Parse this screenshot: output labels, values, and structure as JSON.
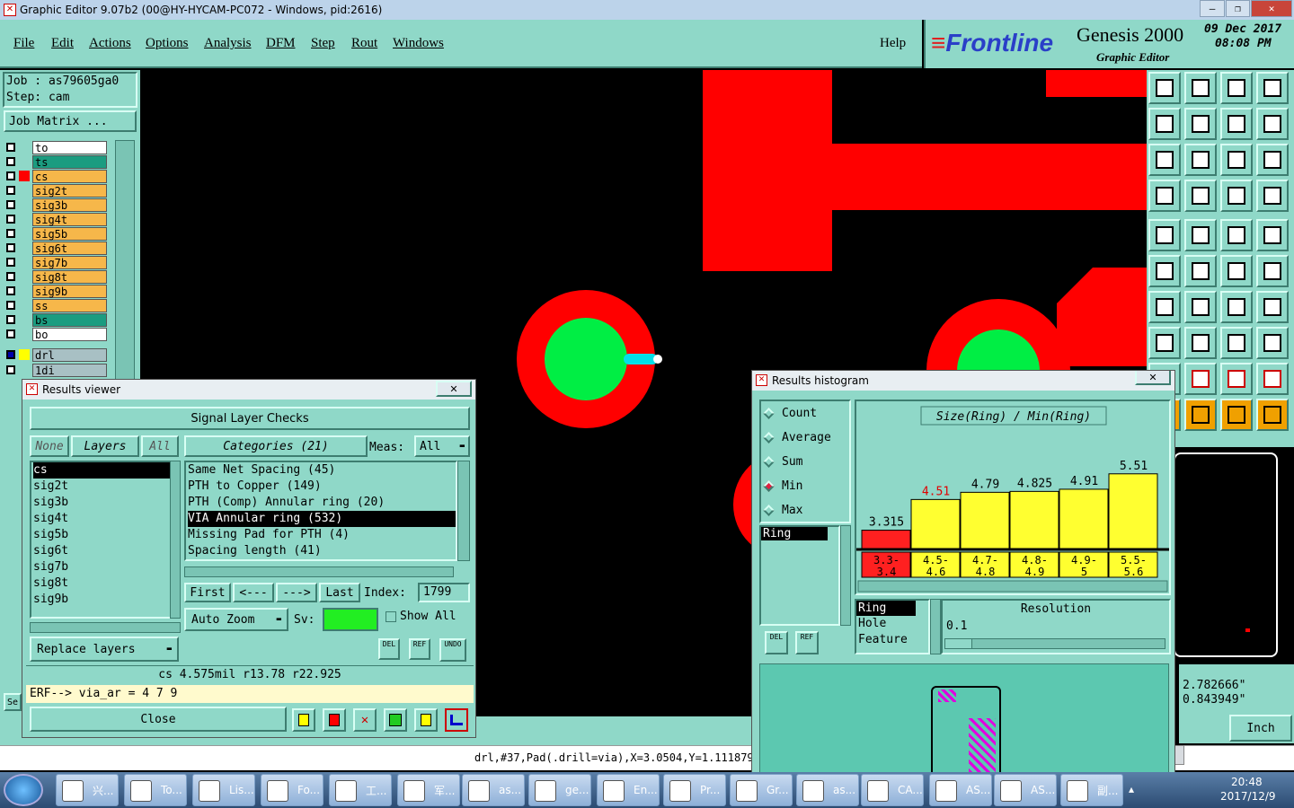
{
  "window": {
    "title": "Graphic Editor 9.07b2 (00@HY-HYCAM-PC072 - Windows, pid:2616)"
  },
  "menu": [
    "File",
    "Edit",
    "Actions",
    "Options",
    "Analysis",
    "DFM",
    "Step",
    "Rout",
    "Windows"
  ],
  "help": "Help",
  "brand": {
    "logo": "Frontline",
    "product": "Genesis 2000",
    "subtitle": "Graphic Editor",
    "date": "09 Dec 2017",
    "time": "08:08 PM"
  },
  "job": {
    "job": "Job : as79605ga0",
    "step": "Step: cam",
    "matrix_button": "Job Matrix ..."
  },
  "layers": [
    {
      "name": "to",
      "color": "#ffffff",
      "swatch": ""
    },
    {
      "name": "ts",
      "color": "#1b9c80",
      "swatch": ""
    },
    {
      "name": "cs",
      "color": "#f6b74a",
      "swatch": "#ff0000"
    },
    {
      "name": "sig2t",
      "color": "#f6b74a",
      "swatch": ""
    },
    {
      "name": "sig3b",
      "color": "#f6b74a",
      "swatch": ""
    },
    {
      "name": "sig4t",
      "color": "#f6b74a",
      "swatch": ""
    },
    {
      "name": "sig5b",
      "color": "#f6b74a",
      "swatch": ""
    },
    {
      "name": "sig6t",
      "color": "#f6b74a",
      "swatch": ""
    },
    {
      "name": "sig7b",
      "color": "#f6b74a",
      "swatch": ""
    },
    {
      "name": "sig8t",
      "color": "#f6b74a",
      "swatch": ""
    },
    {
      "name": "sig9b",
      "color": "#f6b74a",
      "swatch": ""
    },
    {
      "name": "ss",
      "color": "#f6b74a",
      "swatch": ""
    },
    {
      "name": "bs",
      "color": "#1b9c80",
      "swatch": ""
    },
    {
      "name": "bo",
      "color": "#ffffff",
      "swatch": ""
    }
  ],
  "drill_layers": [
    {
      "name": "drl",
      "swatch": "#ffff00"
    },
    {
      "name": "1di",
      "swatch": ""
    }
  ],
  "results_viewer": {
    "title": "Results viewer",
    "header": "Signal Layer Checks",
    "none": "None",
    "layers_label": "Layers",
    "all": "All",
    "categories_label": "Categories (21)",
    "meas_label": "Meas:",
    "meas_value": "All",
    "layer_list": [
      "cs",
      "sig2t",
      "sig3b",
      "sig4t",
      "sig5b",
      "sig6t",
      "sig7b",
      "sig8t",
      "sig9b"
    ],
    "categories": [
      "Same Net Spacing (45)",
      "PTH to Copper (149)",
      "PTH (Comp) Annular ring (20)",
      "VIA Annular ring (532)",
      "Missing Pad for PTH (4)",
      "Spacing length (41)"
    ],
    "selected_category": "VIA Annular ring (532)",
    "first": "First",
    "prev": "<---",
    "next": "--->",
    "last": "Last",
    "index_label": "Index:",
    "index_value": "1799",
    "auto_zoom": "Auto Zoom",
    "sv_label": "Sv:",
    "show_all": "Show All",
    "replace_layers": "Replace layers",
    "del": "DEL",
    "ref": "REF",
    "undo": "UNDO",
    "status": "cs 4.575mil   r13.78   r22.925",
    "erf": "ERF--> via_ar = 4 7 9",
    "close": "Close"
  },
  "histogram": {
    "title": "Results histogram",
    "modes": [
      "Count",
      "Average",
      "Sum",
      "Min",
      "Max"
    ],
    "selected_mode": "Min",
    "list": [
      "Ring"
    ],
    "attrs": [
      "Ring",
      "Hole",
      "Feature"
    ],
    "resolution_label": "Resolution",
    "resolution_value": "0.1",
    "del": "DEL",
    "ref": "REF"
  },
  "chart_data": {
    "type": "bar",
    "title": "Size(Ring) / Min(Ring)",
    "categories": [
      "3.3-3.4",
      "4.5-4.6",
      "4.7-4.8",
      "4.8-4.9",
      "4.9-5",
      "5.5-5.6"
    ],
    "values": [
      3.315,
      4.51,
      4.79,
      4.825,
      4.91,
      5.51
    ],
    "value_labels": [
      "3.315",
      "4.51",
      "4.79",
      "4.825",
      "4.91",
      "5.51"
    ],
    "colors": [
      "#ff2020",
      "#ffff30",
      "#ffff30",
      "#ffff30",
      "#ffff30",
      "#ffff30"
    ]
  },
  "coords": {
    "x": "2.782666\"",
    "y": "0.843949\"",
    "units": "Inch"
  },
  "statusbar": "drl,#37,Pad(.drill=via),X=3.0504,Y=1.1118799",
  "taskbar": {
    "items": [
      "兴...",
      "To...",
      "Lis...",
      "Fo...",
      "工...",
      "军...",
      "as...",
      "ge...",
      "En...",
      "Pr...",
      "Gr...",
      "as...",
      "CA...",
      "AS...",
      "AS...",
      "副..."
    ],
    "clock_time": "20:48",
    "clock_date": "2017/12/9"
  }
}
